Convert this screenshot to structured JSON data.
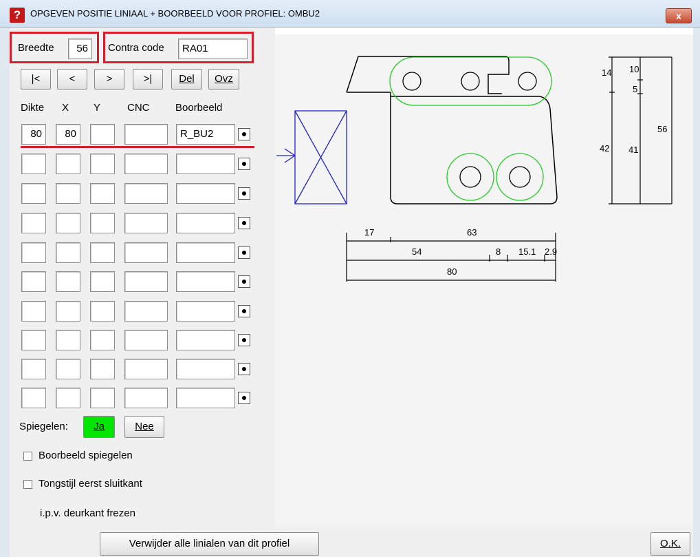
{
  "window": {
    "title": "OPGEVEN POSITIE LINIAAL + BOORBEELD VOOR PROFIEL: OMBU2",
    "close_label": "x",
    "title_icon_label": "?"
  },
  "header": {
    "breedte_label": "Breedte",
    "breedte_value": "56",
    "contra_label": "Contra code",
    "contra_value": "RA01"
  },
  "nav_buttons": [
    {
      "label": "|<"
    },
    {
      "label": "<"
    },
    {
      "label": ">"
    },
    {
      "label": ">|"
    },
    {
      "label": "Del"
    },
    {
      "label": "Ovz"
    }
  ],
  "table": {
    "columns": [
      "Dikte",
      "X",
      "Y",
      "CNC",
      "Boorbeeld"
    ],
    "rows": [
      {
        "dikte": "80",
        "x": "80",
        "y": "",
        "cnc": "",
        "boorbeeld": "R_BU2"
      },
      {
        "dikte": "",
        "x": "",
        "y": "",
        "cnc": "",
        "boorbeeld": ""
      },
      {
        "dikte": "",
        "x": "",
        "y": "",
        "cnc": "",
        "boorbeeld": ""
      },
      {
        "dikte": "",
        "x": "",
        "y": "",
        "cnc": "",
        "boorbeeld": ""
      },
      {
        "dikte": "",
        "x": "",
        "y": "",
        "cnc": "",
        "boorbeeld": ""
      },
      {
        "dikte": "",
        "x": "",
        "y": "",
        "cnc": "",
        "boorbeeld": ""
      },
      {
        "dikte": "",
        "x": "",
        "y": "",
        "cnc": "",
        "boorbeeld": ""
      },
      {
        "dikte": "",
        "x": "",
        "y": "",
        "cnc": "",
        "boorbeeld": ""
      },
      {
        "dikte": "",
        "x": "",
        "y": "",
        "cnc": "",
        "boorbeeld": ""
      },
      {
        "dikte": "",
        "x": "",
        "y": "",
        "cnc": "",
        "boorbeeld": ""
      }
    ]
  },
  "spiegelen": {
    "label": "Spiegelen:",
    "ja_label": "Ja",
    "nee_label": "Nee",
    "active_color": "#00e600"
  },
  "options": {
    "boorbeeld_spiegelen": "Boorbeeld spiegelen",
    "tongstijl": "Tongstijl eerst sluitkant",
    "tongstijl_note": "i.p.v. deurkant frezen"
  },
  "footer": {
    "remove_label": "Verwijder alle linialen van dit profiel",
    "ok_label": "O.K."
  },
  "drawing": {
    "dims_right": [
      "14",
      "10",
      "5",
      "56",
      "42",
      "41"
    ],
    "dims_bottom": [
      "17",
      "63",
      "54",
      "8",
      "15.1",
      "2.9",
      "80"
    ],
    "colors": {
      "outline": "#000000",
      "holes": "#22cc22",
      "ruler": "#2222cc"
    }
  }
}
